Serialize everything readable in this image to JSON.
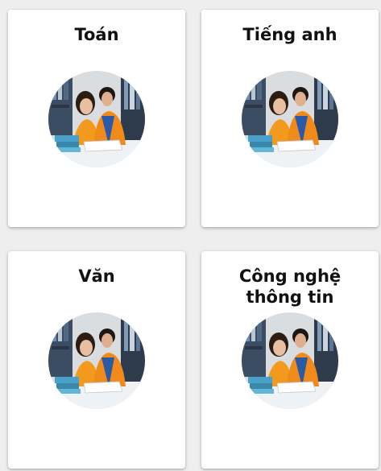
{
  "subjects": [
    {
      "name": "Toán"
    },
    {
      "name": "Tiếng anh"
    },
    {
      "name": "Văn"
    },
    {
      "name": "Công nghệ thông tin"
    }
  ],
  "colors": {
    "background": "#eeeeee",
    "card": "#ffffff",
    "title_text": "#111111"
  },
  "icons": {
    "thumbnail": "students-studying-photo"
  }
}
